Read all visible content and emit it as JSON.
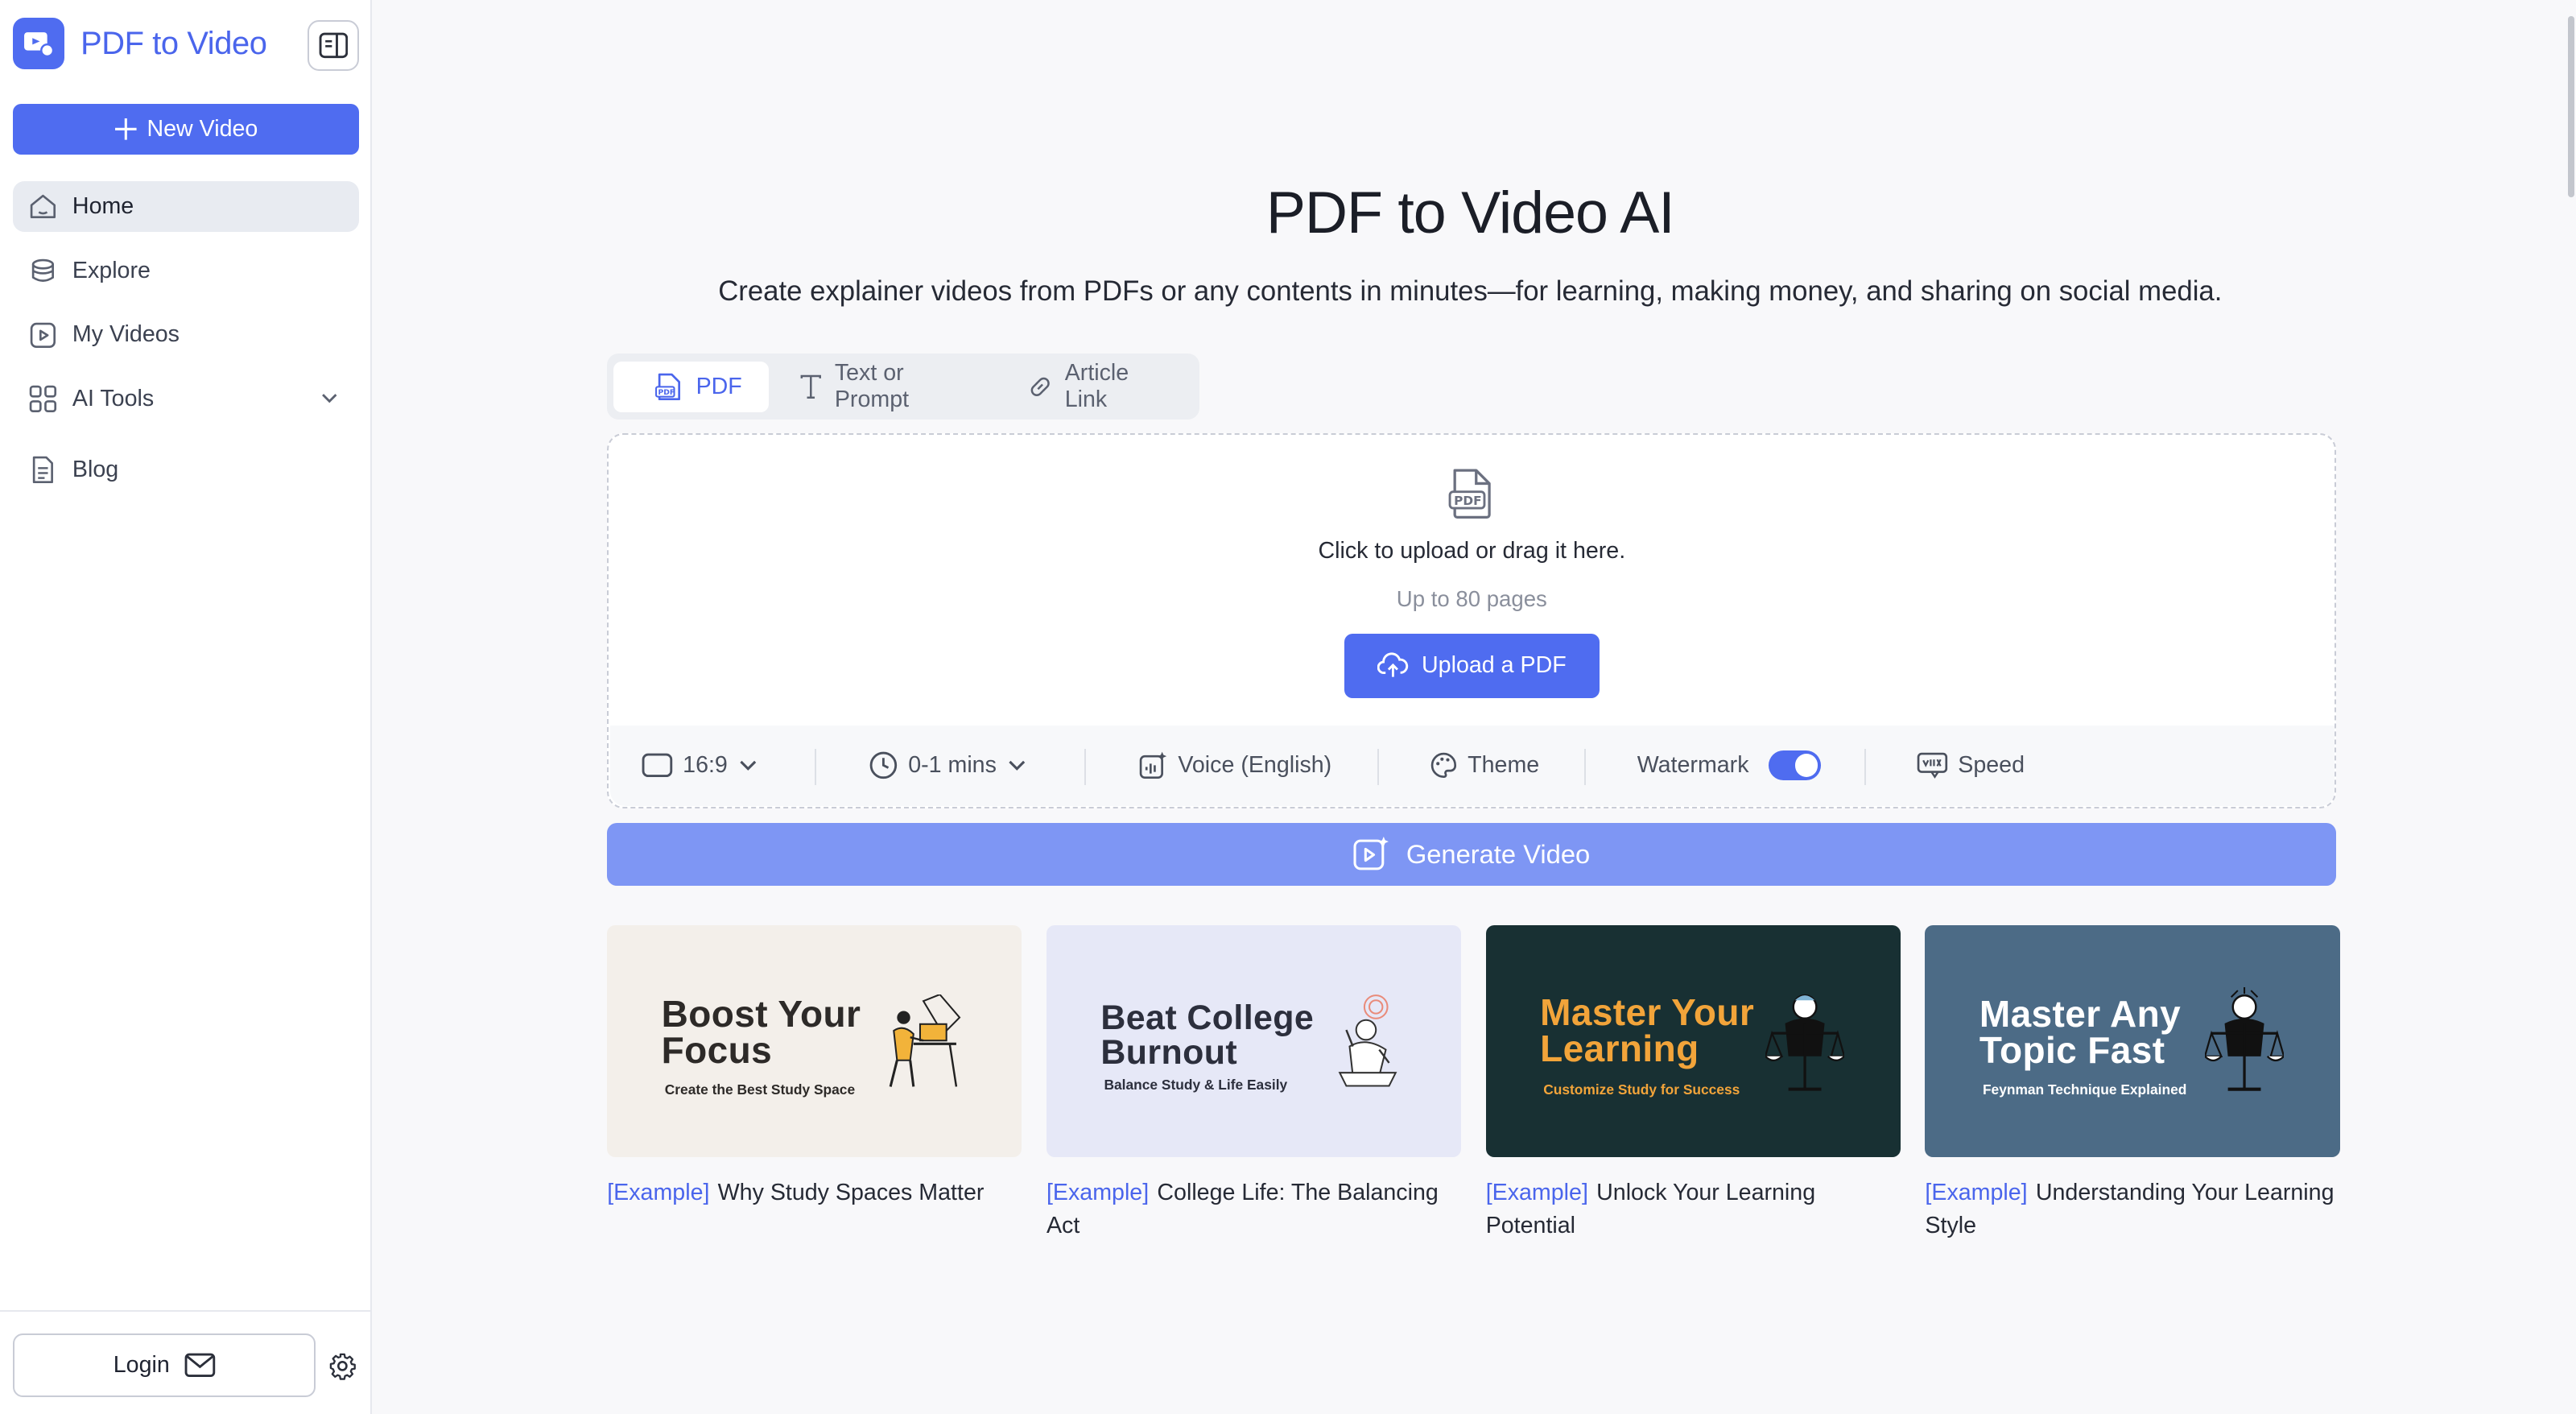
{
  "brand": {
    "name": "PDF to Video",
    "color": "#4f6cf0"
  },
  "sidebar": {
    "new_video_label": "New Video",
    "items": [
      {
        "label": "Home",
        "icon": "home-icon",
        "active": true
      },
      {
        "label": "Explore",
        "icon": "explore-icon"
      },
      {
        "label": "My Videos",
        "icon": "video-icon"
      },
      {
        "label": "AI Tools",
        "icon": "grid-icon",
        "expandable": true
      },
      {
        "label": "Blog",
        "icon": "document-icon"
      }
    ],
    "login_label": "Login"
  },
  "hero": {
    "title": "PDF to Video AI",
    "subtitle": "Create explainer videos from PDFs or any contents in minutes—for learning, making money, and sharing on social media."
  },
  "tabs": [
    {
      "label": "PDF",
      "icon": "pdf-icon",
      "active": true
    },
    {
      "label": "Text or Prompt",
      "icon": "text-icon"
    },
    {
      "label": "Article Link",
      "icon": "link-icon"
    }
  ],
  "upload": {
    "prompt": "Click to upload or drag it here.",
    "limit": "Up to 80 pages",
    "button_label": "Upload a PDF"
  },
  "options": {
    "aspect_ratio": "16:9",
    "duration": "0-1 mins",
    "voice": "Voice (English)",
    "theme": "Theme",
    "watermark": "Watermark",
    "watermark_on": true,
    "speed": "Speed"
  },
  "generate_label": "Generate Video",
  "examples": [
    {
      "tag": "[Example]",
      "caption": "Why Study Spaces Matter",
      "art_title_1": "Boost Your",
      "art_title_2": "Focus",
      "art_sub": "Create the Best Study Space",
      "bg": "#f3efea",
      "title_color": "#2d2a28",
      "sub_color": "#2d2a28"
    },
    {
      "tag": "[Example]",
      "caption": "College Life: The Balancing Act",
      "art_title_1": "Beat College",
      "art_title_2": "Burnout",
      "art_sub": "Balance Study & Life Easily",
      "bg": "#e6e8f7",
      "title_color": "#2c2f3d",
      "sub_color": "#2c2f3d"
    },
    {
      "tag": "[Example]",
      "caption": "Unlock Your Learning Potential",
      "art_title_1": "Master Your",
      "art_title_2": "Learning",
      "art_sub": "Customize Study for Success",
      "bg": "#183033",
      "title_color": "#f2a43a",
      "sub_color": "#f2a43a"
    },
    {
      "tag": "[Example]",
      "caption": "Understanding Your Learning Style",
      "art_title_1": "Master Any",
      "art_title_2": "Topic Fast",
      "art_sub": "Feynman Technique Explained",
      "bg": "#4c6b86",
      "title_color": "#ffffff",
      "sub_color": "#ffffff"
    }
  ]
}
